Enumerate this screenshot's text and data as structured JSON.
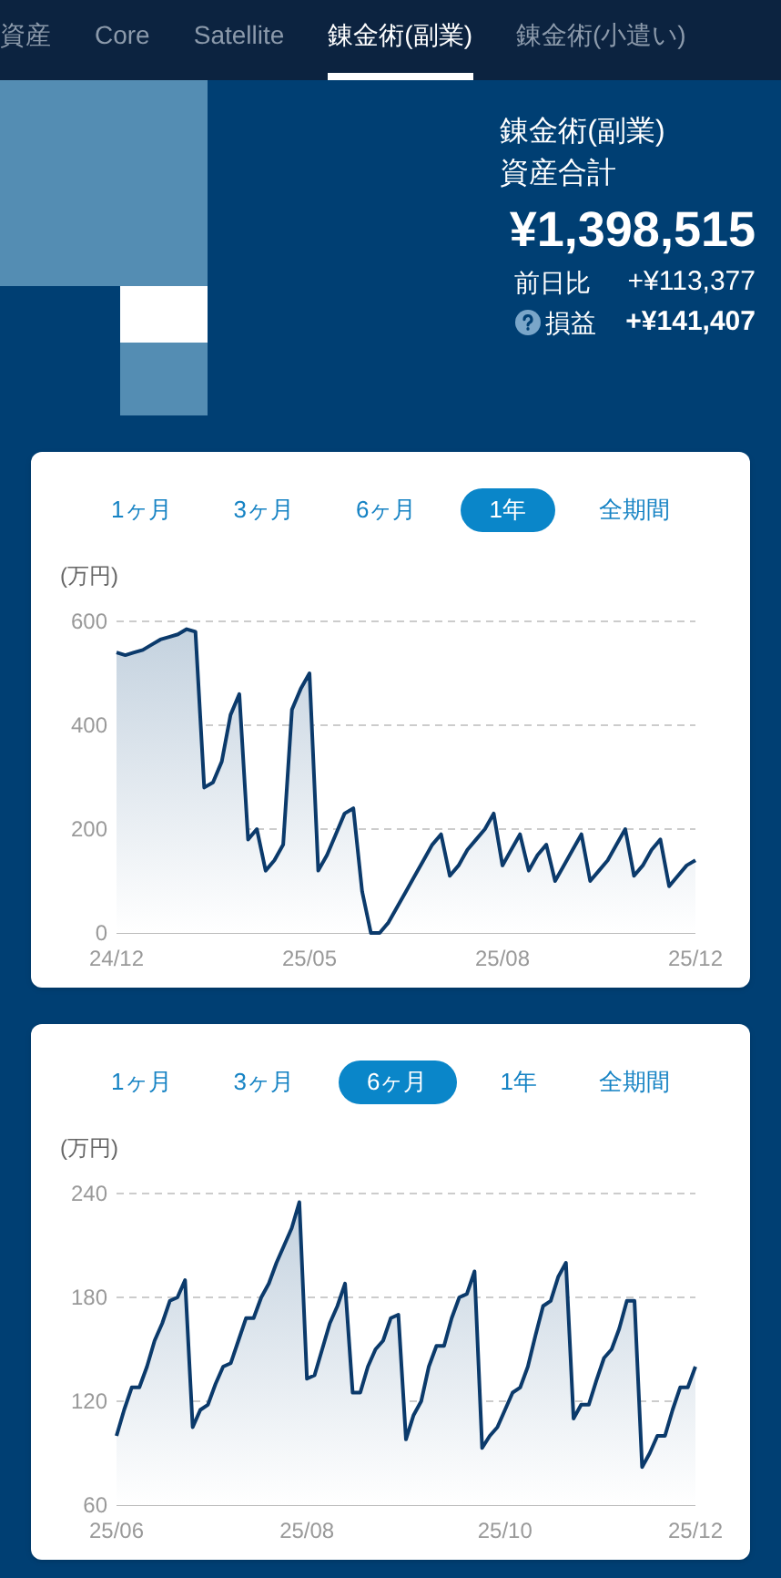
{
  "tabs": [
    {
      "label": "資産",
      "selected": false
    },
    {
      "label": "Core",
      "selected": false
    },
    {
      "label": "Satellite",
      "selected": false
    },
    {
      "label": "錬金術(副業)",
      "selected": true
    },
    {
      "label": "錬金術(小遣い)",
      "selected": false
    }
  ],
  "summary": {
    "name": "錬金術(副業)",
    "label": "資産合計",
    "total": "¥1,398,515",
    "rows": [
      {
        "label": "前日比",
        "value": "+¥113,377",
        "help": false
      },
      {
        "label": "損益",
        "value": "+¥141,407",
        "help": true
      }
    ]
  },
  "charts": [
    {
      "periods": [
        {
          "label": "1ヶ月",
          "selected": false
        },
        {
          "label": "3ヶ月",
          "selected": false
        },
        {
          "label": "6ヶ月",
          "selected": false
        },
        {
          "label": "1年",
          "selected": true
        },
        {
          "label": "全期間",
          "selected": false
        }
      ],
      "chart_data": {
        "type": "area",
        "ylabel": "(万円)",
        "ylim": [
          0,
          600
        ],
        "yticks": [
          0,
          200,
          400,
          600
        ],
        "categories": [
          "24/12",
          null,
          null,
          null,
          null,
          null,
          null,
          null,
          null,
          null,
          null,
          null,
          null,
          null,
          null,
          null,
          null,
          null,
          null,
          null,
          null,
          null,
          "25/05",
          null,
          null,
          null,
          null,
          null,
          null,
          null,
          null,
          null,
          null,
          null,
          null,
          null,
          null,
          null,
          null,
          null,
          null,
          null,
          null,
          null,
          "25/08",
          null,
          null,
          null,
          null,
          null,
          null,
          null,
          null,
          null,
          null,
          null,
          null,
          null,
          null,
          null,
          null,
          null,
          null,
          null,
          null,
          null,
          "25/12"
        ],
        "series": [
          {
            "color": "#0b3a6b",
            "values": [
              540,
              535,
              540,
              545,
              555,
              565,
              570,
              575,
              585,
              580,
              280,
              290,
              330,
              420,
              460,
              180,
              200,
              120,
              140,
              170,
              430,
              470,
              500,
              120,
              150,
              190,
              230,
              240,
              80,
              0,
              0,
              20,
              50,
              80,
              110,
              140,
              170,
              190,
              110,
              130,
              160,
              180,
              200,
              230,
              130,
              160,
              190,
              120,
              150,
              170,
              100,
              130,
              160,
              190,
              100,
              120,
              140,
              170,
              200,
              110,
              130,
              160,
              180,
              90,
              110,
              130,
              140
            ]
          }
        ]
      }
    },
    {
      "periods": [
        {
          "label": "1ヶ月",
          "selected": false
        },
        {
          "label": "3ヶ月",
          "selected": false
        },
        {
          "label": "6ヶ月",
          "selected": true
        },
        {
          "label": "1年",
          "selected": false
        },
        {
          "label": "全期間",
          "selected": false
        }
      ],
      "chart_data": {
        "type": "area",
        "ylabel": "(万円)",
        "ylim": [
          60,
          240
        ],
        "yticks": [
          60,
          120,
          180,
          240
        ],
        "categories": [
          "25/06",
          null,
          null,
          null,
          null,
          null,
          null,
          null,
          null,
          null,
          null,
          null,
          null,
          null,
          null,
          null,
          null,
          null,
          null,
          null,
          null,
          null,
          null,
          null,
          null,
          "25/08",
          null,
          null,
          null,
          null,
          null,
          null,
          null,
          null,
          null,
          null,
          null,
          null,
          null,
          null,
          null,
          null,
          null,
          null,
          null,
          null,
          null,
          null,
          null,
          null,
          null,
          "25/10",
          null,
          null,
          null,
          null,
          null,
          null,
          null,
          null,
          null,
          null,
          null,
          null,
          null,
          null,
          null,
          null,
          null,
          null,
          null,
          null,
          null,
          null,
          null,
          null,
          "25/12"
        ],
        "series": [
          {
            "color": "#0b3a6b",
            "values": [
              100,
              115,
              128,
              128,
              140,
              155,
              165,
              178,
              180,
              190,
              105,
              115,
              118,
              130,
              140,
              142,
              155,
              168,
              168,
              180,
              188,
              200,
              210,
              220,
              235,
              133,
              135,
              150,
              165,
              175,
              188,
              125,
              125,
              140,
              150,
              155,
              168,
              170,
              98,
              112,
              120,
              140,
              152,
              152,
              168,
              180,
              182,
              195,
              93,
              100,
              105,
              115,
              125,
              128,
              140,
              158,
              175,
              178,
              192,
              200,
              110,
              118,
              118,
              132,
              145,
              150,
              162,
              178,
              178,
              82,
              90,
              100,
              100,
              115,
              128,
              128,
              140
            ]
          }
        ]
      }
    }
  ]
}
